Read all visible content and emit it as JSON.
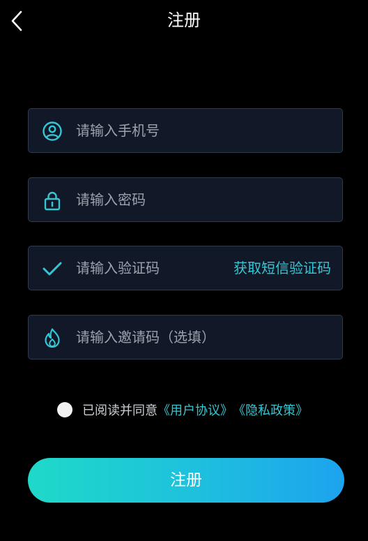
{
  "header": {
    "title": "注册",
    "back_icon": "chevron-left-icon"
  },
  "form": {
    "phone": {
      "placeholder": "请输入手机号",
      "value": "",
      "icon": "user-icon"
    },
    "password": {
      "placeholder": "请输入密码",
      "value": "",
      "icon": "lock-icon"
    },
    "code": {
      "placeholder": "请输入验证码",
      "value": "",
      "icon": "checkmark-icon",
      "get_code_label": "获取短信验证码"
    },
    "invite": {
      "placeholder": "请输入邀请码（选填）",
      "value": "",
      "icon": "flame-icon"
    }
  },
  "agreement": {
    "checked": false,
    "text": "已阅读并同意",
    "user_agreement": "《用户协议》",
    "privacy_policy": "《隐私政策》"
  },
  "submit_label": "注册",
  "colors": {
    "background": "#000000",
    "field_background": "#111827",
    "accent": "#36c6d3",
    "button_gradient_start": "#1fd9c8",
    "button_gradient_end": "#1da3ee"
  }
}
